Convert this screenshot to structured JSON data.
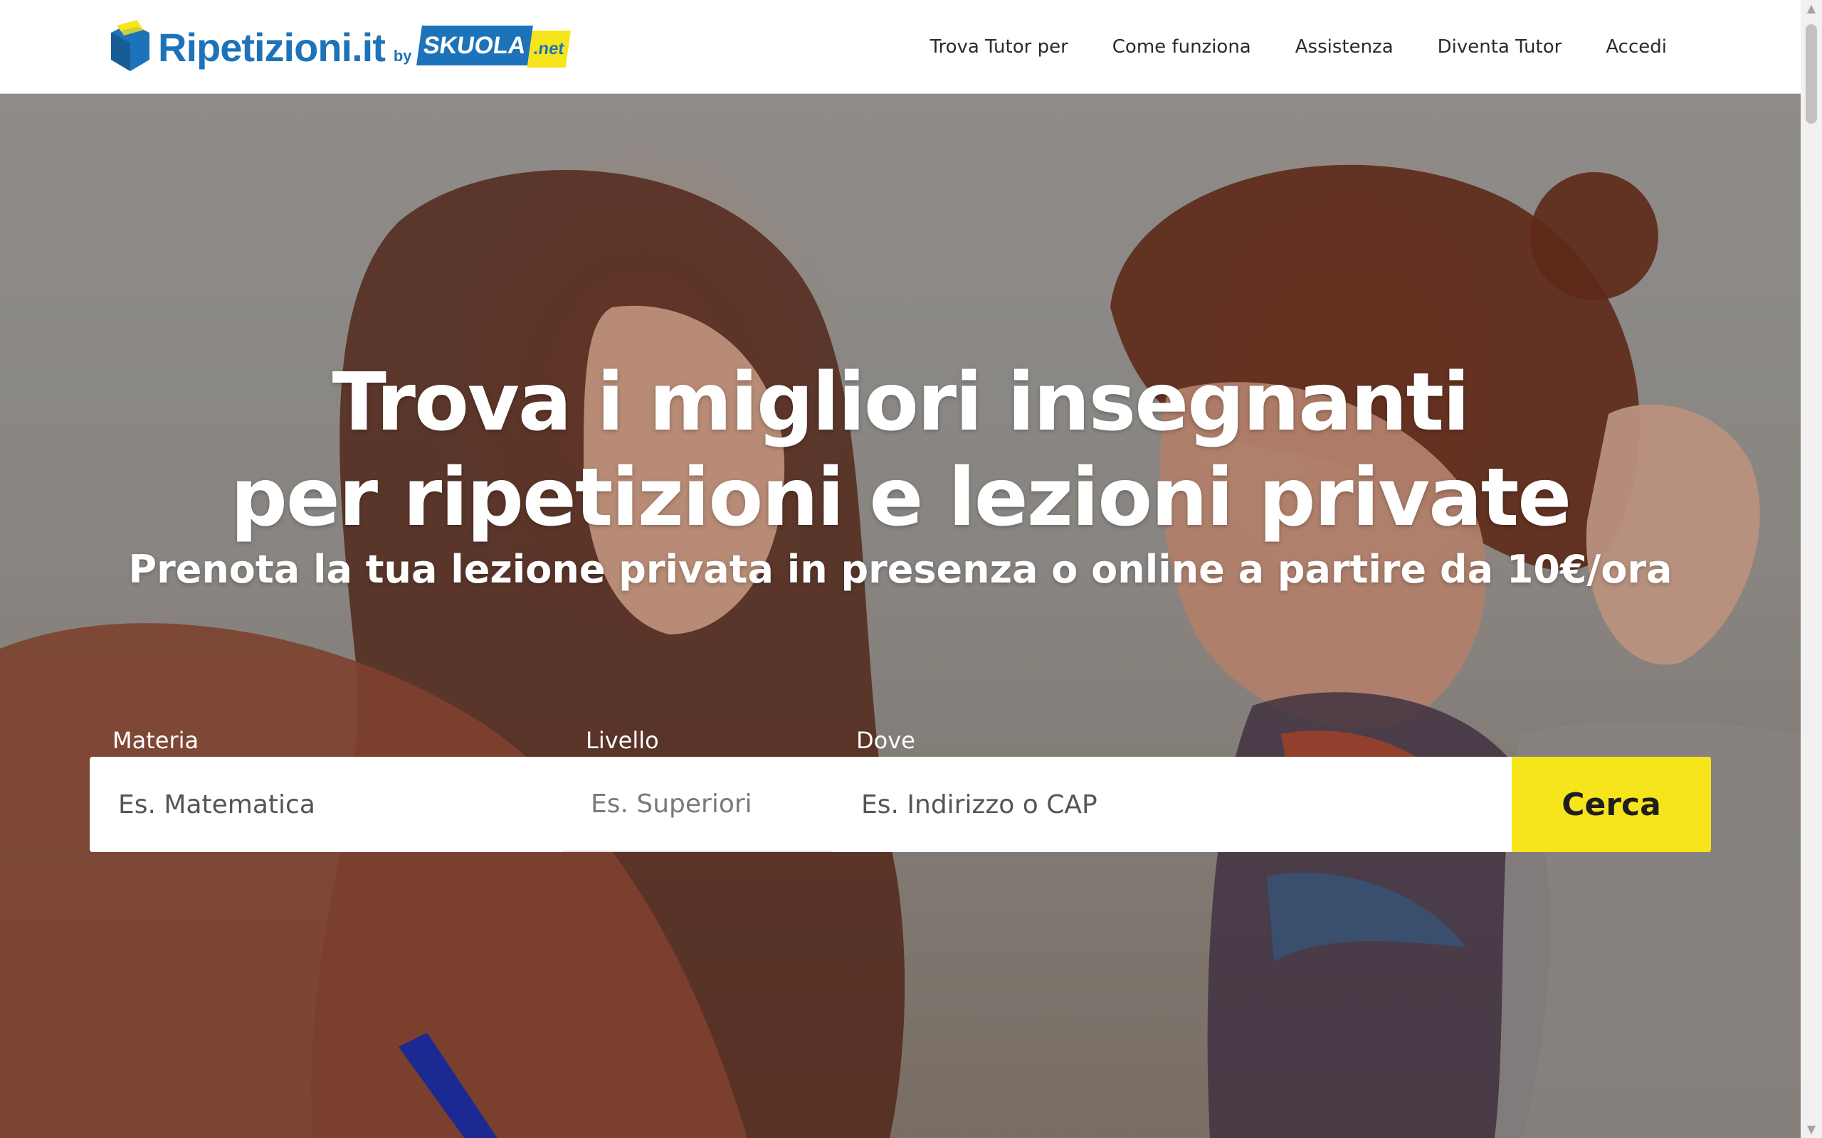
{
  "header": {
    "logo": {
      "word": "Ripetizioni.it",
      "by": "by",
      "badge_main": "SKUOLA",
      "badge_suffix": ".net"
    },
    "nav": [
      {
        "label": "Trova Tutor per"
      },
      {
        "label": "Come funziona"
      },
      {
        "label": "Assistenza"
      },
      {
        "label": "Diventa Tutor"
      },
      {
        "label": "Accedi"
      }
    ]
  },
  "hero": {
    "headline_line1": "Trova i migliori insegnanti",
    "headline_line2": "per ripetizioni e lezioni private",
    "subline": "Prenota la tua lezione privata in presenza o online a partire da 10€/ora"
  },
  "search": {
    "materia": {
      "label": "Materia",
      "placeholder": "Es. Matematica"
    },
    "livello": {
      "label": "Livello",
      "placeholder": "Es. Superiori"
    },
    "dove": {
      "label": "Dove",
      "placeholder": "Es. Indirizzo o CAP"
    },
    "submit_label": "Cerca"
  },
  "colors": {
    "brand_blue": "#1d73b9",
    "accent_yellow": "#f7e51c",
    "text_dark": "#2b2b2b"
  },
  "icons": {
    "logo": "book-cube-icon"
  }
}
